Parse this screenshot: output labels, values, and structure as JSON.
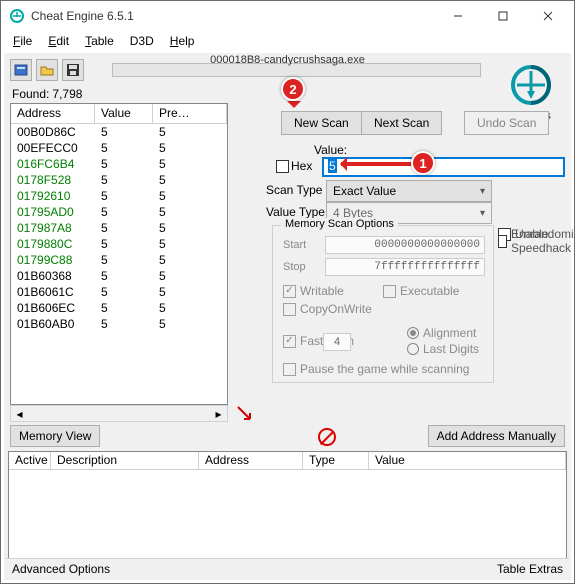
{
  "window": {
    "title": "Cheat Engine 6.5.1"
  },
  "menu": {
    "file": "File",
    "edit": "Edit",
    "table": "Table",
    "d3d": "D3D",
    "help": "Help"
  },
  "process": {
    "name": "000018B8-candycrushsaga.exe"
  },
  "logo": {
    "caption": "Settings"
  },
  "found": {
    "label": "Found:",
    "count": "7,798"
  },
  "grid": {
    "headers": {
      "address": "Address",
      "value": "Value",
      "previous": "Pre…"
    },
    "rows": [
      {
        "addr": "00B0D86C",
        "val": "5",
        "prev": "5",
        "cls": "black"
      },
      {
        "addr": "00EFECC0",
        "val": "5",
        "prev": "5",
        "cls": "black"
      },
      {
        "addr": "016FC6B4",
        "val": "5",
        "prev": "5",
        "cls": "green"
      },
      {
        "addr": "0178F528",
        "val": "5",
        "prev": "5",
        "cls": "green"
      },
      {
        "addr": "01792610",
        "val": "5",
        "prev": "5",
        "cls": "green"
      },
      {
        "addr": "01795AD0",
        "val": "5",
        "prev": "5",
        "cls": "green"
      },
      {
        "addr": "017987A8",
        "val": "5",
        "prev": "5",
        "cls": "green"
      },
      {
        "addr": "0179880C",
        "val": "5",
        "prev": "5",
        "cls": "green"
      },
      {
        "addr": "01799C88",
        "val": "5",
        "prev": "5",
        "cls": "green"
      },
      {
        "addr": "01B60368",
        "val": "5",
        "prev": "5",
        "cls": "black"
      },
      {
        "addr": "01B6061C",
        "val": "5",
        "prev": "5",
        "cls": "black"
      },
      {
        "addr": "01B606EC",
        "val": "5",
        "prev": "5",
        "cls": "black"
      },
      {
        "addr": "01B60AB0",
        "val": "5",
        "prev": "5",
        "cls": "black"
      }
    ]
  },
  "buttons": {
    "memoryView": "Memory View",
    "newScan": "New Scan",
    "nextScan": "Next Scan",
    "undoScan": "Undo Scan",
    "addManual": "Add Address Manually"
  },
  "scan": {
    "valueLabel": "Value:",
    "hexLabel": "Hex",
    "valueInput": "5",
    "scanTypeLabel": "Scan Type",
    "scanTypeValue": "Exact Value",
    "valueTypeLabel": "Value Type",
    "valueTypeValue": "4 Bytes"
  },
  "memopt": {
    "legend": "Memory Scan Options",
    "startLabel": "Start",
    "startValue": "0000000000000000",
    "stopLabel": "Stop",
    "stopValue": "7fffffffffffffff",
    "writable": "Writable",
    "executable": "Executable",
    "copyOnWrite": "CopyOnWrite",
    "fastScan": "Fast Scan",
    "fastScanVal": "4",
    "alignment": "Alignment",
    "lastDigits": "Last Digits",
    "pause": "Pause the game while scanning"
  },
  "rightopts": {
    "unrandomizer": "Unrandomizer",
    "speedhack": "Enable Speedhack"
  },
  "cheattable": {
    "headers": {
      "active": "Active",
      "desc": "Description",
      "address": "Address",
      "type": "Type",
      "value": "Value"
    }
  },
  "status": {
    "left": "Advanced Options",
    "right": "Table Extras"
  },
  "callouts": {
    "one": "1",
    "two": "2"
  }
}
